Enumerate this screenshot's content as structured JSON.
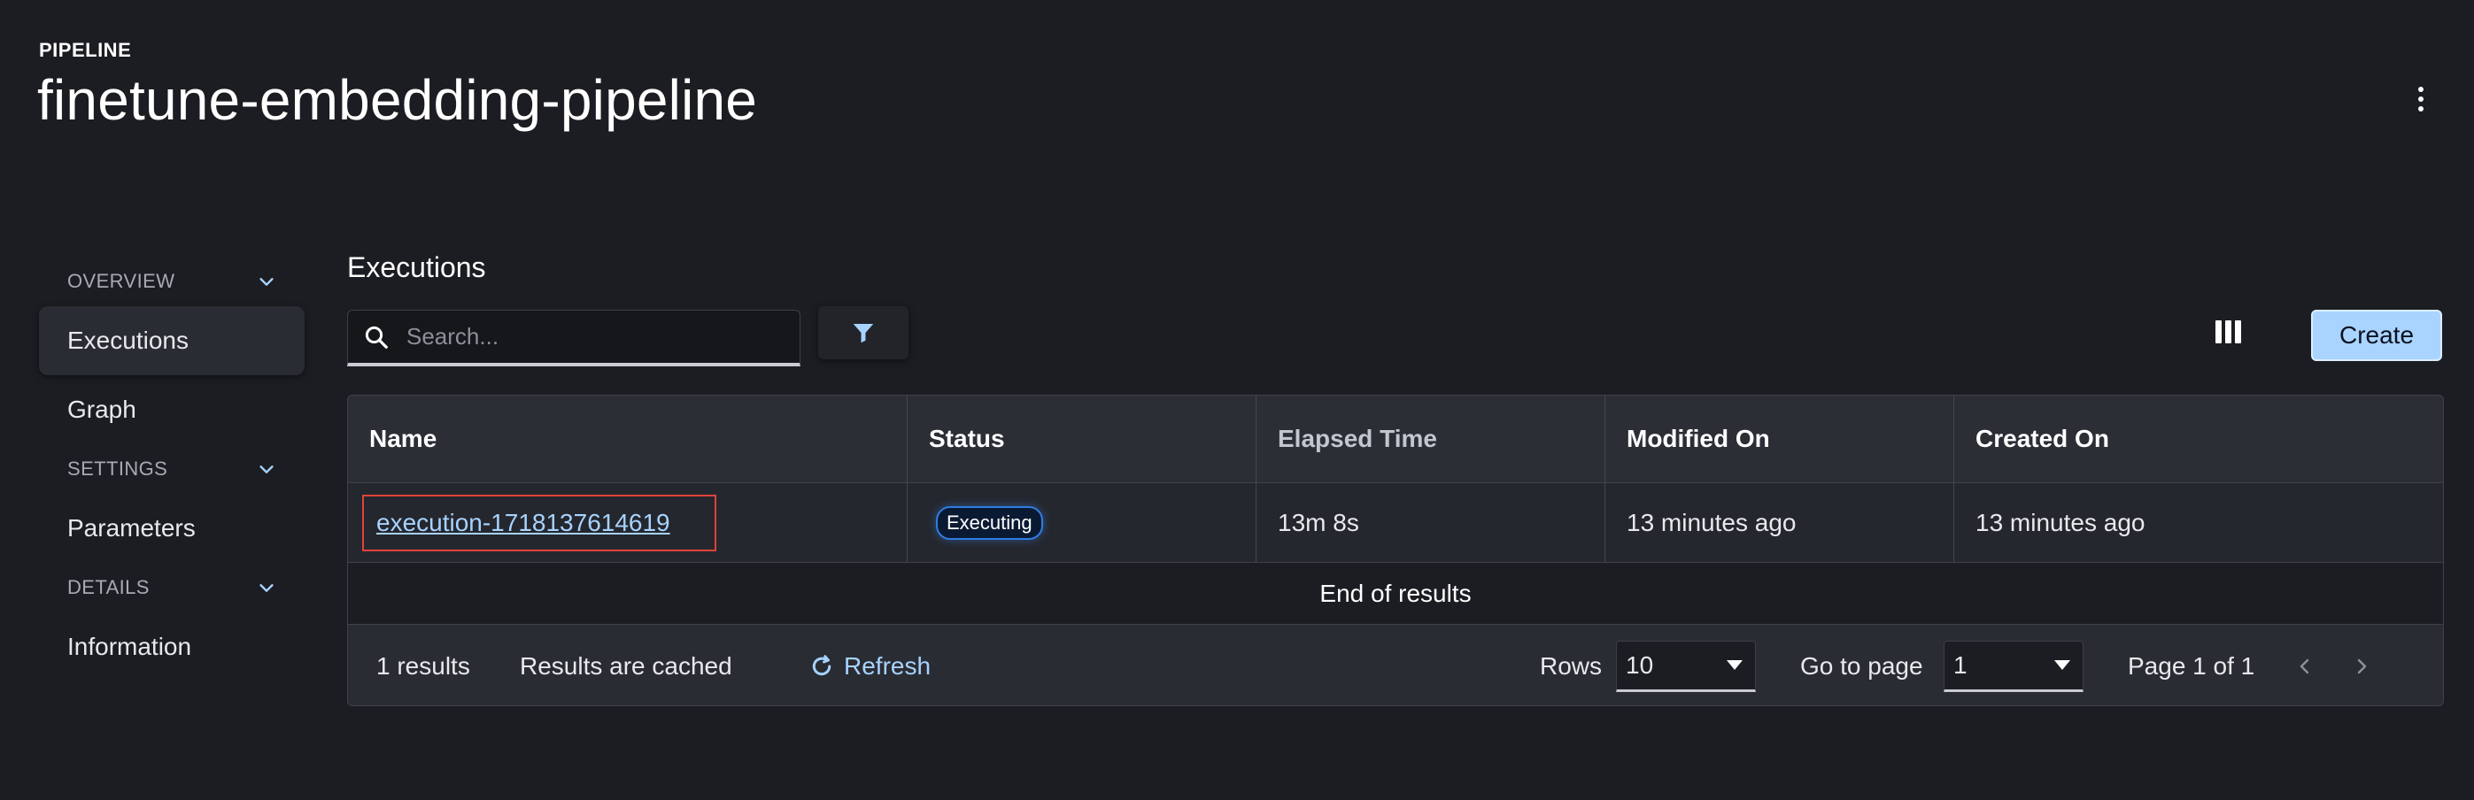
{
  "header": {
    "eyebrow": "PIPELINE",
    "title": "finetune-embedding-pipeline",
    "menu_icon": "more-vertical-icon"
  },
  "sidebar": {
    "sections": [
      {
        "label": "OVERVIEW",
        "items": [
          {
            "label": "Executions",
            "active": true
          },
          {
            "label": "Graph",
            "active": false
          }
        ]
      },
      {
        "label": "SETTINGS",
        "items": [
          {
            "label": "Parameters",
            "active": false
          }
        ]
      },
      {
        "label": "DETAILS",
        "items": [
          {
            "label": "Information",
            "active": false
          }
        ]
      }
    ]
  },
  "main": {
    "title": "Executions",
    "search": {
      "placeholder": "Search...",
      "value": ""
    },
    "create_label": "Create",
    "table": {
      "columns": [
        "Name",
        "Status",
        "Elapsed Time",
        "Modified On",
        "Created On"
      ],
      "rows": [
        {
          "name": "execution-1718137614619",
          "status": "Executing",
          "elapsed": "13m 8s",
          "modified": "13 minutes ago",
          "created": "13 minutes ago"
        }
      ],
      "end_text": "End of results"
    },
    "footer": {
      "results_count": "1 results",
      "cache_text": "Results are cached",
      "refresh_label": "Refresh",
      "rows_label": "Rows",
      "rows_value": "10",
      "goto_label": "Go to page",
      "goto_value": "1",
      "page_info": "Page 1 of 1"
    }
  },
  "colors": {
    "background": "#1c1d22",
    "accent": "#a9d4ff",
    "link": "#a7d3ff",
    "highlight_box": "#e0423a",
    "status_border": "#2f7de0"
  }
}
